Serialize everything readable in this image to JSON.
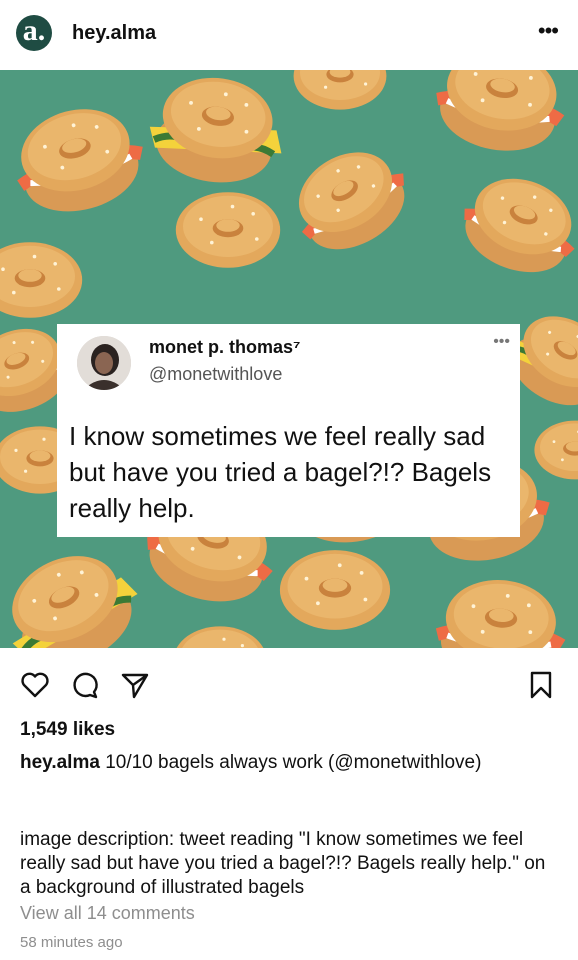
{
  "header": {
    "avatar_letter": "a.",
    "account_name": "hey.alma",
    "more_icon": "ellipsis-icon"
  },
  "post": {
    "image_icon": "illustrated-bagels-pattern",
    "colors": {
      "background": "#4f9a7f",
      "bagel": "#e3a85c",
      "salmon": "#ee6b45",
      "cheese": "#f4d23b",
      "lettuce": "#3b7a35"
    },
    "tweet": {
      "display_name": "monet p. thomas⁷",
      "handle": "@monetwithlove",
      "text": "I know sometimes we feel really sad but have you tried a bagel?!? Bagels really help."
    }
  },
  "actions": {
    "like_icon": "heart-icon",
    "comment_icon": "comment-icon",
    "share_icon": "send-icon",
    "save_icon": "bookmark-icon"
  },
  "likes": "1,549 likes",
  "caption": {
    "username": "hey.alma",
    "text": "10/10 bagels always work (@monetwithlove)"
  },
  "image_description": "image description: tweet reading \"I know sometimes we feel really sad but have you tried a bagel?!? Bagels really help.\" on a background of illustrated bagels",
  "view_comments": "View all 14 comments",
  "timestamp": "58 minutes ago"
}
